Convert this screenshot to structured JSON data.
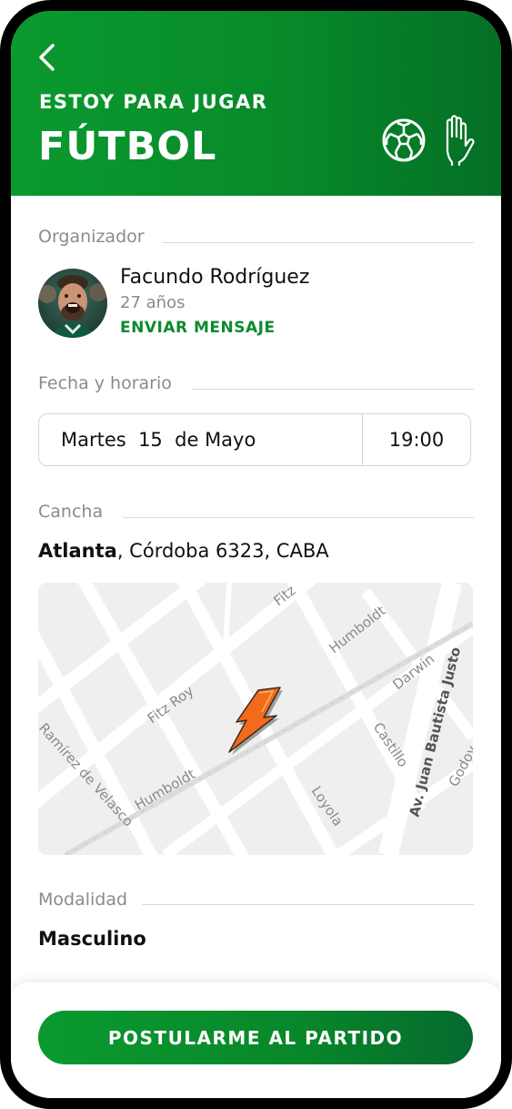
{
  "header": {
    "subtitle": "ESTOY PARA JUGAR",
    "title": "FÚTBOL"
  },
  "organizer": {
    "section_label": "Organizador",
    "name": "Facundo Rodríguez",
    "age": "27 años",
    "message_link": "ENVIAR MENSAJE"
  },
  "schedule": {
    "section_label": "Fecha y horario",
    "date": "Martes  15  de Mayo",
    "time": "19:00"
  },
  "court": {
    "section_label": "Cancha",
    "venue": "Atlanta",
    "address": ", Córdoba 6323, CABA"
  },
  "map": {
    "streets": [
      "Fitz Roy",
      "Humboldt",
      "Humboldt",
      "Darwin",
      "Av. Juan Bautista Justo",
      "Castillo",
      "Loyola",
      "Ramírez de Velasco",
      "Fitz",
      "Godoy"
    ]
  },
  "modality": {
    "section_label": "Modalidad",
    "value": "Masculino"
  },
  "cta": {
    "label": "POSTULARME AL PARTIDO"
  },
  "colors": {
    "brand_green": "#0a9a2f",
    "pin_orange": "#f26a1b"
  }
}
